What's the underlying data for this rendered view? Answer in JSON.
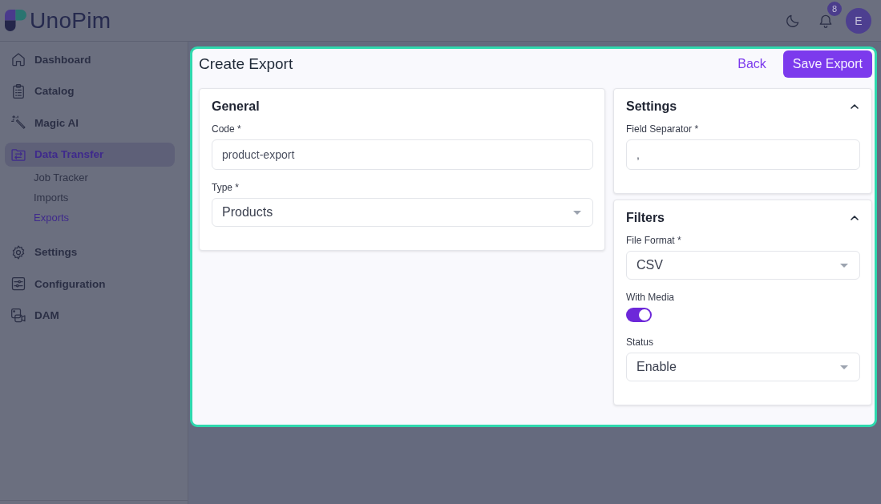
{
  "app": {
    "logo": "UnoPim"
  },
  "header": {
    "notification_badge": "8",
    "avatar_initial": "E"
  },
  "sidebar": {
    "items": [
      {
        "label": "Dashboard",
        "selected": false
      },
      {
        "label": "Catalog",
        "selected": false
      },
      {
        "label": "Magic AI",
        "selected": false
      },
      {
        "label": "Data Transfer",
        "selected": true,
        "children": [
          {
            "label": "Job Tracker",
            "selected": false
          },
          {
            "label": "Imports",
            "selected": false
          },
          {
            "label": "Exports",
            "selected": true
          }
        ]
      },
      {
        "label": "Settings",
        "selected": false
      },
      {
        "label": "Configuration",
        "selected": false
      },
      {
        "label": "DAM",
        "selected": false
      }
    ]
  },
  "page": {
    "title": "Create Export",
    "back_link": "Back",
    "save_button": "Save Export"
  },
  "general": {
    "title": "General",
    "fields": [
      {
        "kind": "text",
        "label": "Code *",
        "value": "product-export"
      },
      {
        "kind": "select",
        "label": "Type *",
        "value": "Products"
      }
    ]
  },
  "settings": {
    "title": "Settings",
    "expanded": true,
    "fields": [
      {
        "kind": "text",
        "label": "Field Separator *",
        "value": ","
      }
    ]
  },
  "filters": {
    "title": "Filters",
    "expanded": true,
    "fields": [
      {
        "kind": "select",
        "label": "File Format *",
        "value": "CSV"
      },
      {
        "kind": "toggle",
        "label": "With Media",
        "on": true
      },
      {
        "kind": "select",
        "label": "Status",
        "value": "Enable"
      }
    ]
  }
}
